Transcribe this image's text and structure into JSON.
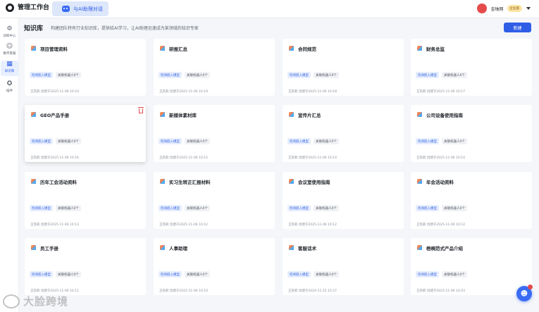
{
  "topbar": {
    "brand": "管理工作台",
    "ai_tab": "与AI助理对话",
    "user_name": "金柚网",
    "user_badge": "企业版"
  },
  "sidebar": {
    "items": [
      {
        "label": "训练中心",
        "icon": "gear-icon",
        "active": false
      },
      {
        "label": "数字客服",
        "icon": "bot-icon",
        "active": false
      },
      {
        "label": "知识库",
        "icon": "book-icon",
        "active": true
      },
      {
        "label": "插件",
        "icon": "plugin-icon",
        "active": false
      }
    ]
  },
  "header": {
    "title": "知识库",
    "description": "构建团队特有行业知识库，提供给AI学习，让AI助理迅速成为某领域的知识专家",
    "new_button": "新建"
  },
  "cards": [
    {
      "title": "项目管理资料",
      "tag1": "检阅嵌入模型",
      "tag2": "关联机器人0个",
      "meta": "王凯莉   创建于2025-11-06 10:19"
    },
    {
      "title": "研报汇总",
      "tag1": "检阅嵌入模型",
      "tag2": "关联机器人0个",
      "meta": "王凯莉   创建于2025-11-06 10:19"
    },
    {
      "title": "合同规范",
      "tag1": "检阅嵌入模型",
      "tag2": "关联机器人0个",
      "meta": "王凯莉   创建于2025-11-06 10:18"
    },
    {
      "title": "财务总监",
      "tag1": "检阅嵌入模型",
      "tag2": "关联机器人0个",
      "meta": "王凯莉   创建于2025-11-06 10:17"
    },
    {
      "title": "GEO产品手册",
      "tag1": "检阅嵌入模型",
      "tag2": "关联机器人0个",
      "meta": "王凯莉   创建于2025-11-06 10:16"
    },
    {
      "title": "新媒体素材库",
      "tag1": "检阅嵌入模型",
      "tag2": "关联机器人0个",
      "meta": "王凯莉   创建于2025-11-06 10:15"
    },
    {
      "title": "宣传片汇总",
      "tag1": "检阅嵌入模型",
      "tag2": "关联机器人0个",
      "meta": "王凯莉   创建于2025-11-06 10:14"
    },
    {
      "title": "公司设备使用指南",
      "tag1": "检阅嵌入模型",
      "tag2": "关联机器人0个",
      "meta": "王凯莉   创建于2025-11-06 10:14"
    },
    {
      "title": "历年工会活动资料",
      "tag1": "检阅嵌入模型",
      "tag2": "关联机器人0个",
      "meta": "王凯莉   创建于2025-11-06 10:13"
    },
    {
      "title": "实习生转正汇报材料",
      "tag1": "检阅嵌入模型",
      "tag2": "关联机器人0个",
      "meta": "王凯莉   创建于2025-11-06 10:12"
    },
    {
      "title": "会议室使用指南",
      "tag1": "检阅嵌入模型",
      "tag2": "关联机器人0个",
      "meta": "王凯莉   创建于2025-11-06 10:12"
    },
    {
      "title": "年会活动资料",
      "tag1": "检阅嵌入模型",
      "tag2": "关联机器人0个",
      "meta": "王凯莉   创建于2025-11-06 10:12"
    },
    {
      "title": "员工手册",
      "tag1": "检阅嵌入模型",
      "tag2": "关联机器人0个",
      "meta": "王凯莉   创建于2025-11-06 10:11"
    },
    {
      "title": "人事助理",
      "tag1": "检阅嵌入模型",
      "tag2": "关联机器人0个",
      "meta": "王凯莉   创建于2025-11-06 10:10"
    },
    {
      "title": "客服话术",
      "tag1": "检阅嵌入模型",
      "tag2": "关联机器人0个",
      "meta": "王凯莉   创建于2024-11-25 15:27"
    },
    {
      "title": "梧桐范式产品介绍",
      "tag1": "检阅嵌入模型",
      "tag2": "关联机器人0个",
      "meta": "王凯莉   创建于2025-11-06 14:03"
    }
  ],
  "watermark": "大脸跨境",
  "colors": {
    "accent": "#2f5ee6",
    "danger": "#e54b4b"
  }
}
